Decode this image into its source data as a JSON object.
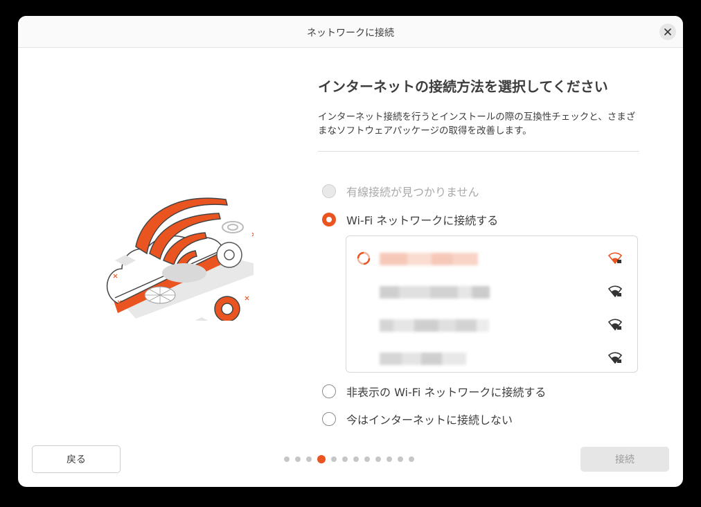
{
  "window": {
    "title": "ネットワークに接続",
    "close_icon": "close-icon"
  },
  "main": {
    "heading": "インターネットの接続方法を選択してください",
    "description": "インターネット接続を行うとインストールの際の互換性チェックと、さまざまなソフトウェアパッケージの取得を改善します。",
    "options": [
      {
        "label": "有線接続が見つかりません",
        "state": "disabled"
      },
      {
        "label": "Wi-Fi ネットワークに接続する",
        "state": "checked"
      },
      {
        "label": "非表示の Wi-Fi ネットワークに接続する",
        "state": "unchecked"
      },
      {
        "label": "今はインターネットに接続しない",
        "state": "unchecked"
      }
    ],
    "wifi_networks": [
      {
        "ssid": "(blurred)",
        "connecting": true,
        "secured": true,
        "icon": "wifi-secure-icon",
        "color": "#e95420"
      },
      {
        "ssid": "(blurred)",
        "connecting": false,
        "secured": true,
        "icon": "wifi-secure-icon",
        "color": "#3d3d3d"
      },
      {
        "ssid": "(blurred)",
        "connecting": false,
        "secured": true,
        "icon": "wifi-secure-icon",
        "color": "#3d3d3d"
      },
      {
        "ssid": "(blurred)",
        "connecting": false,
        "secured": true,
        "icon": "wifi-secure-icon",
        "color": "#3d3d3d"
      }
    ]
  },
  "footer": {
    "back_label": "戻る",
    "connect_label": "接続",
    "pager": {
      "current_page": 4,
      "total_pages": 12
    }
  },
  "colors": {
    "accent": "#e95420",
    "window_bg": "#ffffff",
    "disabled_text": "#a9a9a9"
  }
}
